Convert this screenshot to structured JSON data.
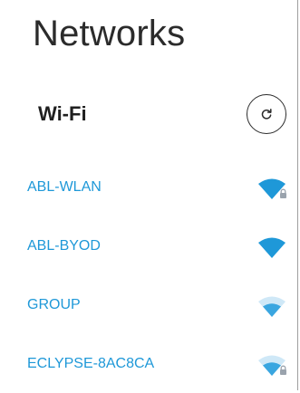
{
  "page": {
    "title": "Networks"
  },
  "wifi_section": {
    "title": "Wi-Fi",
    "refresh_icon": "refresh-icon"
  },
  "networks": [
    {
      "name": "ABL-WLAN",
      "signal": "strong",
      "secured": true,
      "icon": "wifi-locked-icon"
    },
    {
      "name": "ABL-BYOD",
      "signal": "strong",
      "secured": false,
      "icon": "wifi-icon"
    },
    {
      "name": "GROUP",
      "signal": "medium",
      "secured": false,
      "icon": "wifi-icon"
    },
    {
      "name": "ECLYPSE-8AC8CA",
      "signal": "medium",
      "secured": true,
      "icon": "wifi-locked-icon"
    }
  ],
  "colors": {
    "accent": "#1e98d8",
    "strong_signal": "#1e98d8",
    "medium_signal_front": "#3aa6e0",
    "medium_signal_back": "#cfe8f7",
    "lock": "#9aa3ad",
    "text_dark": "#2b2b2b"
  }
}
